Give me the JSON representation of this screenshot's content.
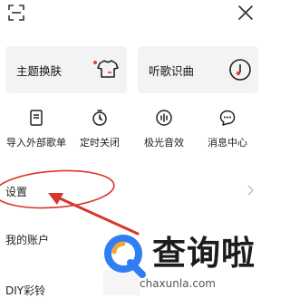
{
  "header": {
    "scan_icon": "scan-icon",
    "close_icon": "close-icon"
  },
  "cards": [
    {
      "label": "主题换肤",
      "icon": "shirt-icon",
      "has_dot": true
    },
    {
      "label": "听歌识曲",
      "icon": "music-disc-icon"
    }
  ],
  "quick_actions": [
    {
      "label": "导入外部歌单",
      "icon": "import-playlist-icon"
    },
    {
      "label": "定时关闭",
      "icon": "timer-icon"
    },
    {
      "label": "极光音效",
      "icon": "sound-effect-icon"
    },
    {
      "label": "消息中心",
      "icon": "message-icon"
    }
  ],
  "menu": [
    {
      "label": "设置"
    },
    {
      "label": "我的账户"
    },
    {
      "label": "DIY彩铃"
    }
  ],
  "watermark": {
    "title": "查询啦",
    "url": "chaxunla.com"
  },
  "colors": {
    "card_bg": "#f3f3f3",
    "annotation_red": "#d8362c",
    "watermark_blue": "#2f7ff2",
    "watermark_orange": "#f2a531",
    "dot_red": "#e43c3c"
  }
}
